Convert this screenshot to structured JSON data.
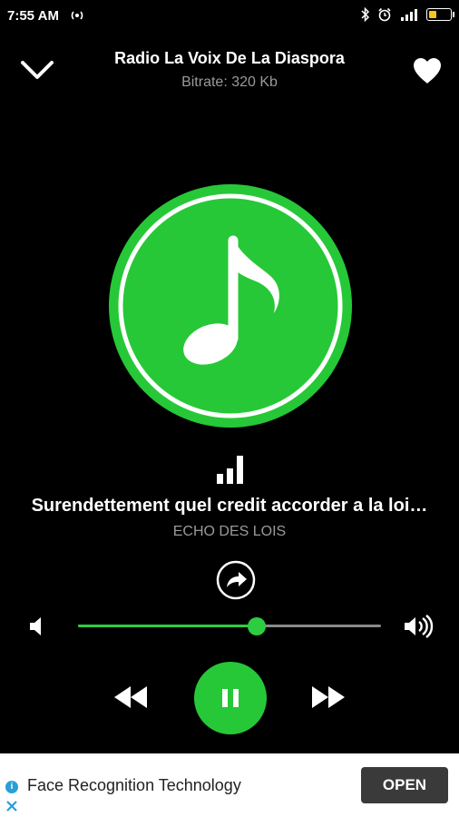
{
  "status": {
    "time": "7:55 AM"
  },
  "header": {
    "station_title": "Radio La Voix De La Diaspora",
    "bitrate": "Bitrate: 320 Kb"
  },
  "player": {
    "track_title": "Surendettement quel credit accorder a la loi…",
    "artist": "ECHO DES LOIS",
    "volume": 0.59,
    "accent_color": "#26c837"
  },
  "ad": {
    "text": "Face Recognition Technology",
    "button_label": "OPEN"
  }
}
